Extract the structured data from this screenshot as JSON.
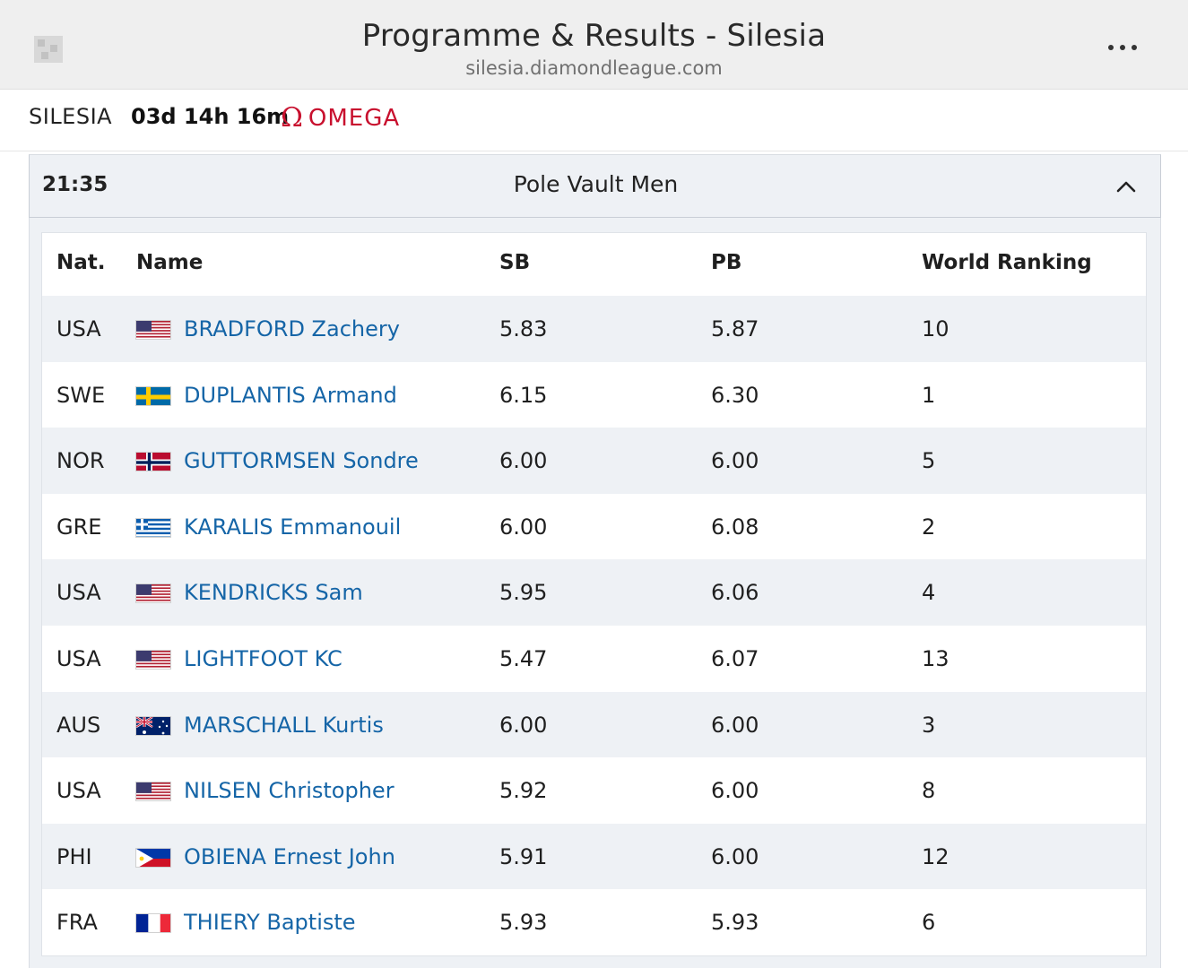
{
  "browser": {
    "title": "Programme & Results - Silesia",
    "url": "silesia.diamondleague.com",
    "menu_icon": "more-dots-icon"
  },
  "header": {
    "meeting": "SILESIA",
    "countdown": "03d 14h 16m",
    "sponsor_symbol": "Ω",
    "sponsor": "OMEGA",
    "sponsor_color": "#c8102e"
  },
  "event": {
    "time": "21:35",
    "name": "Pole Vault Men",
    "toggle_icon": "chevron-up-icon"
  },
  "table": {
    "columns": {
      "nat": "Nat.",
      "name": "Name",
      "sb": "SB",
      "pb": "PB",
      "wr": "World Ranking"
    },
    "rows": [
      {
        "nat": "USA",
        "flag": "usa",
        "name": "BRADFORD Zachery",
        "sb": "5.83",
        "pb": "5.87",
        "wr": "10"
      },
      {
        "nat": "SWE",
        "flag": "swe",
        "name": "DUPLANTIS Armand",
        "sb": "6.15",
        "pb": "6.30",
        "wr": "1"
      },
      {
        "nat": "NOR",
        "flag": "nor",
        "name": "GUTTORMSEN Sondre",
        "sb": "6.00",
        "pb": "6.00",
        "wr": "5"
      },
      {
        "nat": "GRE",
        "flag": "gre",
        "name": "KARALIS Emmanouil",
        "sb": "6.00",
        "pb": "6.08",
        "wr": "2"
      },
      {
        "nat": "USA",
        "flag": "usa",
        "name": "KENDRICKS Sam",
        "sb": "5.95",
        "pb": "6.06",
        "wr": "4"
      },
      {
        "nat": "USA",
        "flag": "usa",
        "name": "LIGHTFOOT KC",
        "sb": "5.47",
        "pb": "6.07",
        "wr": "13"
      },
      {
        "nat": "AUS",
        "flag": "aus",
        "name": "MARSCHALL Kurtis",
        "sb": "6.00",
        "pb": "6.00",
        "wr": "3"
      },
      {
        "nat": "USA",
        "flag": "usa",
        "name": "NILSEN Christopher",
        "sb": "5.92",
        "pb": "6.00",
        "wr": "8"
      },
      {
        "nat": "PHI",
        "flag": "phi",
        "name": "OBIENA Ernest John",
        "sb": "5.91",
        "pb": "6.00",
        "wr": "12"
      },
      {
        "nat": "FRA",
        "flag": "fra",
        "name": "THIERY Baptiste",
        "sb": "5.93",
        "pb": "5.93",
        "wr": "6"
      }
    ]
  },
  "colors": {
    "name_link": "#1565a7",
    "row_alt_bg": "#eef1f5"
  }
}
